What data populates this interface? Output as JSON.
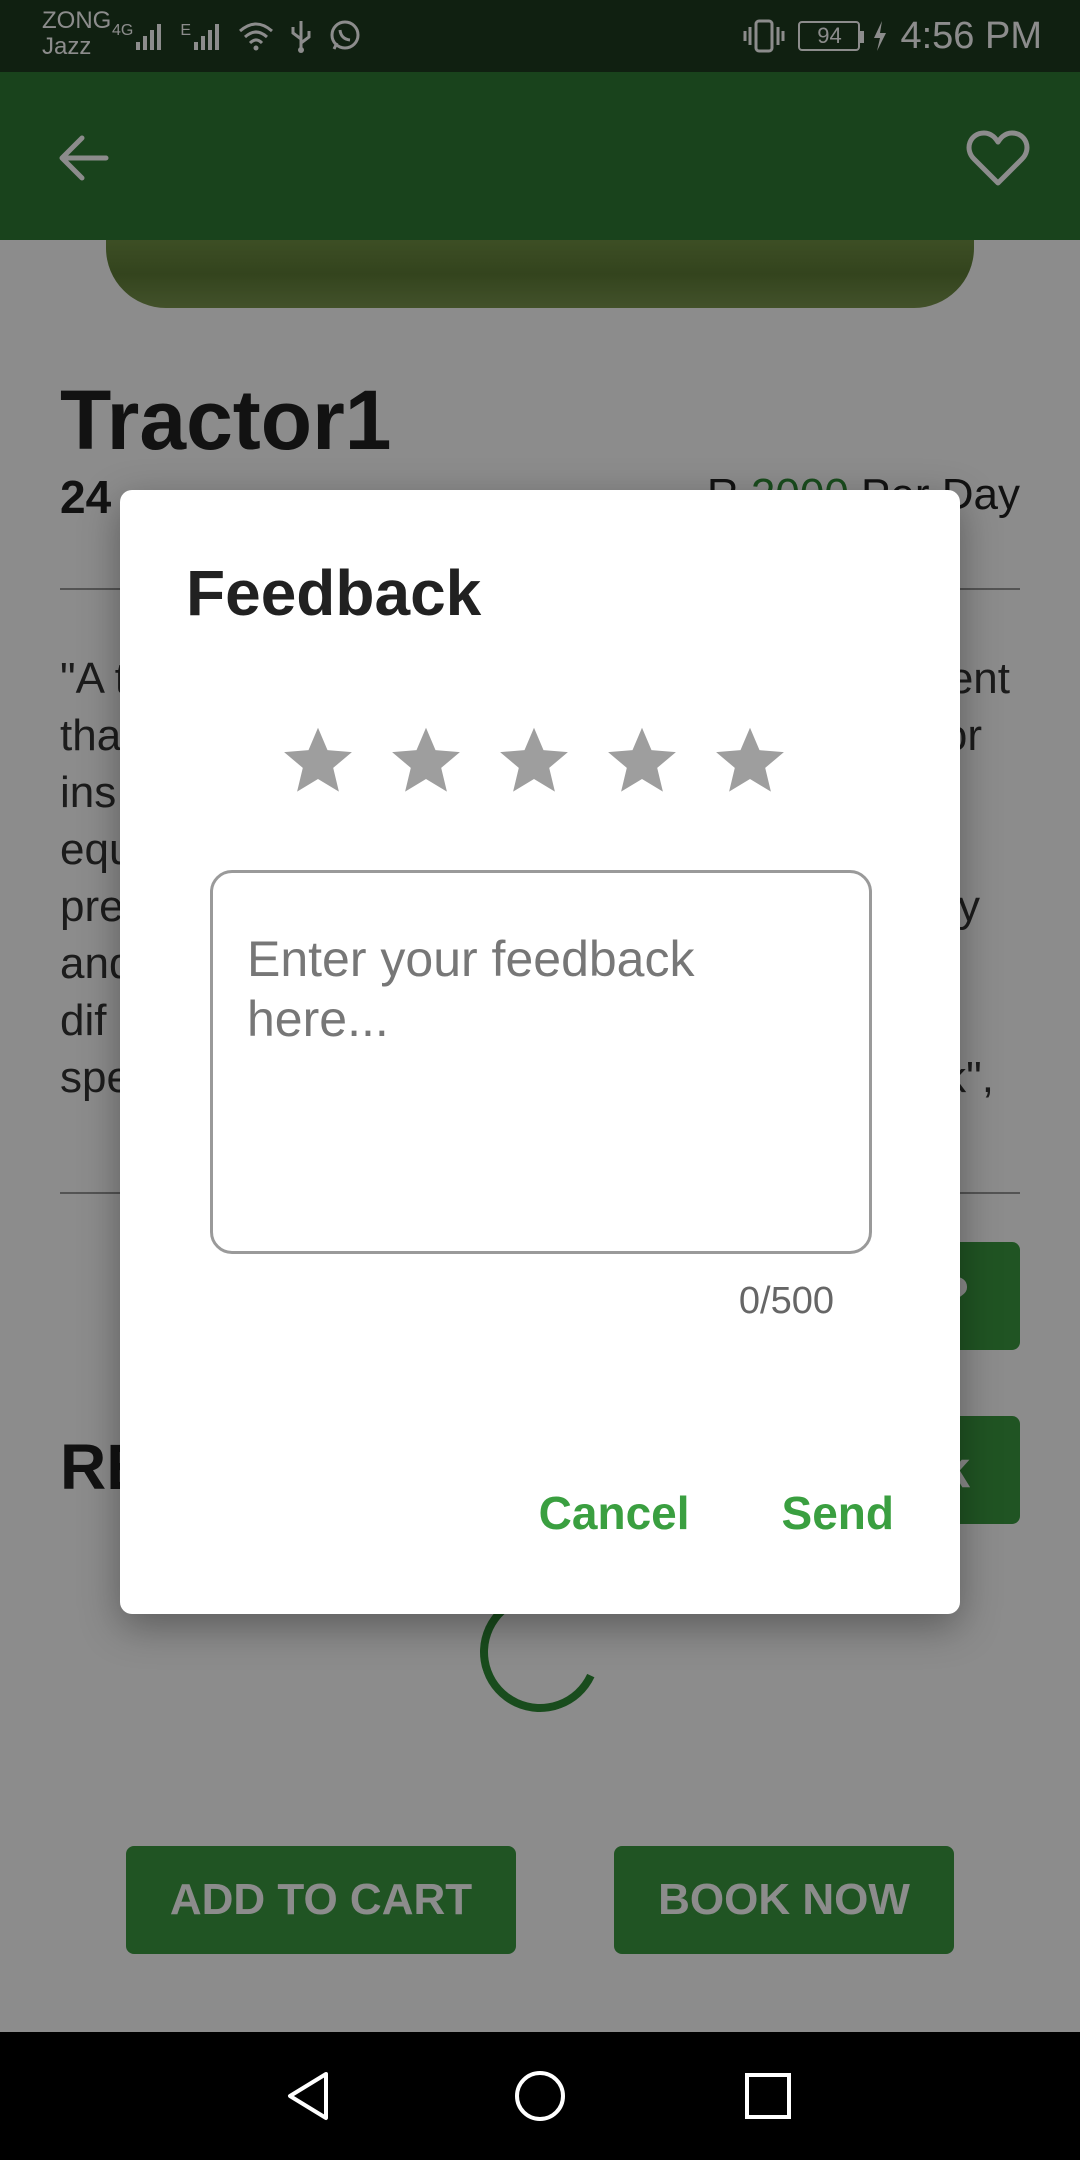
{
  "status_bar": {
    "carrier_1": "ZONG",
    "carrier_2": "Jazz",
    "network_tag": "4G",
    "network_tag_2": "E",
    "battery": "94",
    "time": "4:56 PM"
  },
  "app_bar": {
    "back_icon": "arrow-left-icon",
    "favorite_icon": "heart-outline-icon"
  },
  "product": {
    "title": "Tractor1",
    "subtitle_partial": "24",
    "price_prefix": "R",
    "price_value": "2000",
    "price_suffix": "Per Day",
    "description_partial": [
      "\"A t",
      "tha",
      "ins",
      "equ",
      "pre",
      "and",
      "dif",
      "spe"
    ],
    "description_right_fragments": [
      "ent",
      "or",
      "",
      "",
      "y",
      "",
      "",
      "k\","
    ],
    "side_button_1": "?",
    "side_button_2": "k",
    "reviews_heading_partial": "RE"
  },
  "bottom_buttons": {
    "add_to_cart": "ADD TO CART",
    "book_now": "BOOK NOW"
  },
  "dialog": {
    "title": "Feedback",
    "star_count": 5,
    "star_color": "#9e9e9e",
    "placeholder": "Enter your feedback here...",
    "counter": "0/500",
    "cancel_label": "Cancel",
    "send_label": "Send",
    "accent_color": "#3a9f40"
  },
  "colors": {
    "primary": "#2f7a33",
    "status_bar": "#1e3b1f",
    "button_green": "#3b9a40"
  }
}
